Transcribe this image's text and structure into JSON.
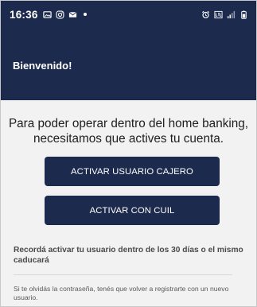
{
  "status_bar": {
    "time": "16:36",
    "left_icons": [
      "gallery-icon",
      "instagram-icon",
      "mail-icon",
      "dot-icon"
    ],
    "right_icons": [
      "alarm-icon",
      "lte-icon",
      "signal-icon",
      "battery-icon"
    ]
  },
  "header": {
    "title": "Bienvenido!"
  },
  "main": {
    "intro_text": "Para poder operar dentro del home banking, necesitamos que actives tu cuenta.",
    "buttons": {
      "activate_cashier_user": "ACTIVAR USUARIO CAJERO",
      "activate_with_cuil": "ACTIVAR CON CUIL"
    },
    "reminder_text": "Recordá activar tu usuario dentro de los 30 días o el mismo caducará",
    "note_text": "Si te olvidás la contraseña, tenés que volver a registrarte con un nuevo usuario."
  },
  "colors": {
    "navy": "#1c2b4d",
    "background": "#f2f2f2",
    "text": "#1e1e1e"
  }
}
